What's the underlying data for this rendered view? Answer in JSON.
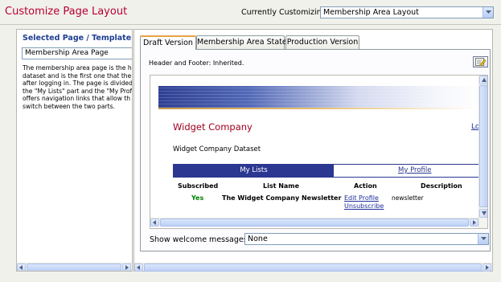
{
  "header": {
    "title": "Customize Page Layout",
    "customizing_label": "Currently Customizing:",
    "customizing_value": "Membership Area Layout"
  },
  "left_panel": {
    "heading": "Selected Page / Template:",
    "page_value": "Membership Area Page",
    "description": "The membership area page is the h\ndataset and is the first one that the\nafter logging in. The page is divided\nthe \"My Lists\" part and the \"My Prof\noffers navigation links that allow th\nswitch between the two parts."
  },
  "tabs": [
    {
      "label": "Draft Version",
      "active": true
    },
    {
      "label": "Membership Area State",
      "active": false
    },
    {
      "label": "Production Version",
      "active": false
    }
  ],
  "draft": {
    "header_footer_text": "Header and Footer: Inherited.",
    "edit_icon": "edit-pencil-icon",
    "preview": {
      "company_name": "Widget Company",
      "logout_link": "Lo",
      "dataset_name": "Widget Company Dataset",
      "tab_my_lists": "My Lists",
      "tab_my_profile": "My Profile",
      "columns": [
        "Subscribed",
        "List Name",
        "Action",
        "Description"
      ],
      "rows": [
        {
          "subscribed": "Yes",
          "list_name": "The Widget Company Newsletter",
          "action_edit": "Edit Profile",
          "action_unsubscribe": "Unsubscribe",
          "description": "newsletter"
        }
      ]
    },
    "welcome_label": "Show welcome messages:",
    "welcome_value": "None"
  },
  "colors": {
    "title_red": "#b8002e",
    "heading_blue": "#1d3e91",
    "preview_navy": "#2b3790",
    "yes_green": "#008000",
    "active_tab_accent": "#e7a33f"
  }
}
